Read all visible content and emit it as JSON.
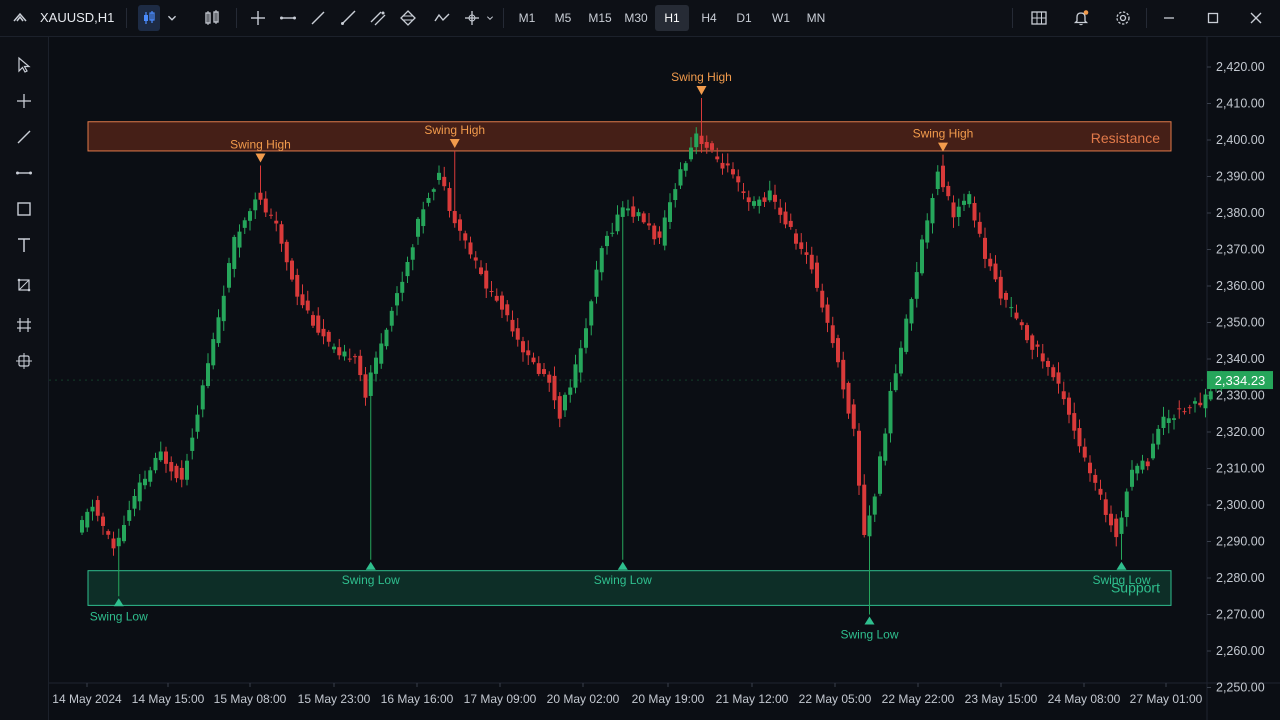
{
  "toolbar": {
    "symbol": "XAUUSD,H1",
    "timeframes": [
      "M1",
      "M5",
      "M15",
      "M30",
      "H1",
      "H4",
      "D1",
      "W1",
      "MN"
    ],
    "active_timeframe": "H1"
  },
  "chart_data": {
    "type": "candlestick",
    "symbol": "XAUUSD",
    "timeframe": "H1",
    "ylim": [
      2250,
      2425
    ],
    "y_ticks": [
      "2,420.00",
      "2,410.00",
      "2,400.00",
      "2,390.00",
      "2,380.00",
      "2,370.00",
      "2,360.00",
      "2,350.00",
      "2,340.00",
      "2,330.00",
      "2,320.00",
      "2,310.00",
      "2,300.00",
      "2,290.00",
      "2,280.00",
      "2,270.00",
      "2,260.00",
      "2,250.00"
    ],
    "x_ticks": [
      "14 May 2024",
      "14 May 15:00",
      "15 May 08:00",
      "15 May 23:00",
      "16 May 16:00",
      "17 May 09:00",
      "20 May 02:00",
      "20 May 19:00",
      "21 May 12:00",
      "22 May 05:00",
      "22 May 22:00",
      "23 May 15:00",
      "24 May 08:00",
      "27 May 01:00"
    ],
    "current_price": 2334.23,
    "current_price_label": "2,334.23",
    "colors": {
      "up": "#26a65b",
      "down": "#d93a3a",
      "resistance": "#e27a4a",
      "support": "#2fbf8e",
      "swing_high": "#f29b4c",
      "swing_low": "#2fbf8e"
    },
    "zones": [
      {
        "label": "Resistance",
        "top": 2405,
        "bottom": 2397
      },
      {
        "label": "Support",
        "top": 2282,
        "bottom": 2272.5
      }
    ],
    "swing_highs": [
      {
        "label": "Swing High",
        "price": 2393,
        "candle": 34
      },
      {
        "label": "Swing High",
        "price": 2397,
        "candle": 71
      },
      {
        "label": "Swing High",
        "price": 2411.5,
        "candle": 118
      },
      {
        "label": "Swing High",
        "price": 2396,
        "candle": 164
      }
    ],
    "swing_lows": [
      {
        "label": "Swing Low",
        "price": 2275,
        "candle": 7
      },
      {
        "label": "Swing Low",
        "price": 2285,
        "candle": 55
      },
      {
        "label": "Swing Low",
        "price": 2285,
        "candle": 103
      },
      {
        "label": "Swing Low",
        "price": 2270,
        "candle": 150
      },
      {
        "label": "Swing Low",
        "price": 2285,
        "candle": 198
      }
    ],
    "anchors": [
      [
        0,
        2292
      ],
      [
        3,
        2300
      ],
      [
        7,
        2288
      ],
      [
        12,
        2305
      ],
      [
        16,
        2314
      ],
      [
        20,
        2307
      ],
      [
        26,
        2345
      ],
      [
        30,
        2372
      ],
      [
        34,
        2385
      ],
      [
        38,
        2376
      ],
      [
        42,
        2358
      ],
      [
        46,
        2348
      ],
      [
        50,
        2340
      ],
      [
        53,
        2342
      ],
      [
        55,
        2330
      ],
      [
        58,
        2345
      ],
      [
        62,
        2362
      ],
      [
        66,
        2382
      ],
      [
        69,
        2391
      ],
      [
        71,
        2382
      ],
      [
        74,
        2372
      ],
      [
        78,
        2360
      ],
      [
        82,
        2352
      ],
      [
        86,
        2340
      ],
      [
        90,
        2334
      ],
      [
        92,
        2325
      ],
      [
        96,
        2342
      ],
      [
        100,
        2370
      ],
      [
        104,
        2382
      ],
      [
        108,
        2378
      ],
      [
        111,
        2372
      ],
      [
        114,
        2388
      ],
      [
        118,
        2402
      ],
      [
        121,
        2396
      ],
      [
        124,
        2392
      ],
      [
        128,
        2382
      ],
      [
        132,
        2385
      ],
      [
        136,
        2375
      ],
      [
        140,
        2365
      ],
      [
        144,
        2345
      ],
      [
        148,
        2320
      ],
      [
        150,
        2292
      ],
      [
        152,
        2303
      ],
      [
        155,
        2330
      ],
      [
        158,
        2350
      ],
      [
        161,
        2372
      ],
      [
        164,
        2392
      ],
      [
        167,
        2380
      ],
      [
        170,
        2384
      ],
      [
        173,
        2368
      ],
      [
        176,
        2358
      ],
      [
        180,
        2348
      ],
      [
        184,
        2340
      ],
      [
        188,
        2330
      ],
      [
        192,
        2312
      ],
      [
        196,
        2298
      ],
      [
        198,
        2292
      ],
      [
        201,
        2310
      ],
      [
        204,
        2312
      ],
      [
        206,
        2322
      ],
      [
        210,
        2326
      ],
      [
        214,
        2328
      ],
      [
        217,
        2334
      ]
    ]
  }
}
